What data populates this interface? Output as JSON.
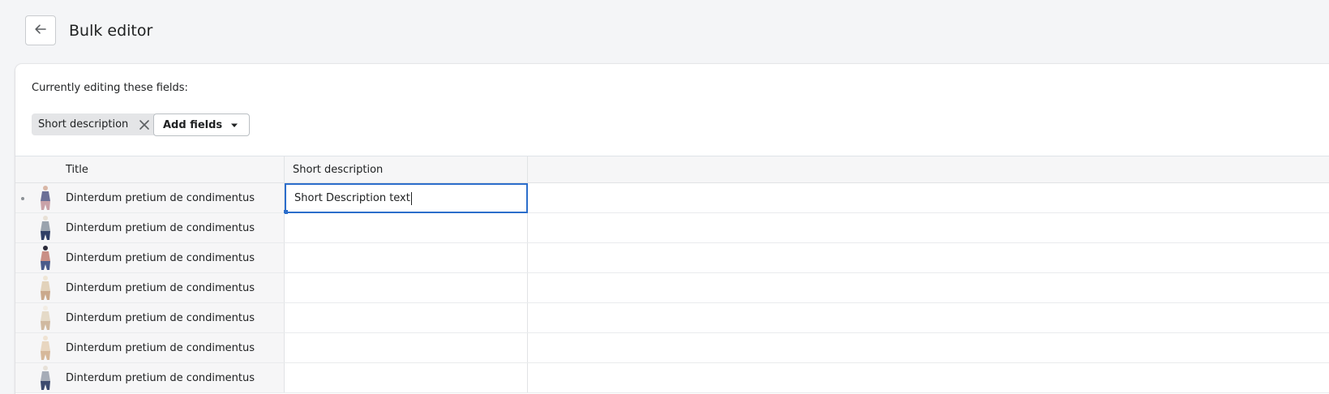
{
  "header": {
    "title": "Bulk editor",
    "back_icon": "arrow-left-icon"
  },
  "editor": {
    "editing_label": "Currently editing these fields:",
    "fields": [
      {
        "label": "Short description",
        "remove_icon": "close-icon"
      }
    ],
    "add_fields_label": "Add fields",
    "add_fields_icon": "caret-down-icon"
  },
  "table": {
    "columns": [
      "Title",
      "Short description"
    ],
    "active_row": 0,
    "rows": [
      {
        "title": "Dinterdum pretium de condimentus",
        "short_description": "Short Description text"
      },
      {
        "title": "Dinterdum pretium de condimentus",
        "short_description": ""
      },
      {
        "title": "Dinterdum pretium de condimentus",
        "short_description": ""
      },
      {
        "title": "Dinterdum pretium de condimentus",
        "short_description": ""
      },
      {
        "title": "Dinterdum pretium de condimentus",
        "short_description": ""
      },
      {
        "title": "Dinterdum pretium de condimentus",
        "short_description": ""
      },
      {
        "title": "Dinterdum pretium de condimentus",
        "short_description": ""
      }
    ]
  },
  "colors": {
    "accent": "#2c6ecb",
    "background": "#f4f5f7"
  }
}
